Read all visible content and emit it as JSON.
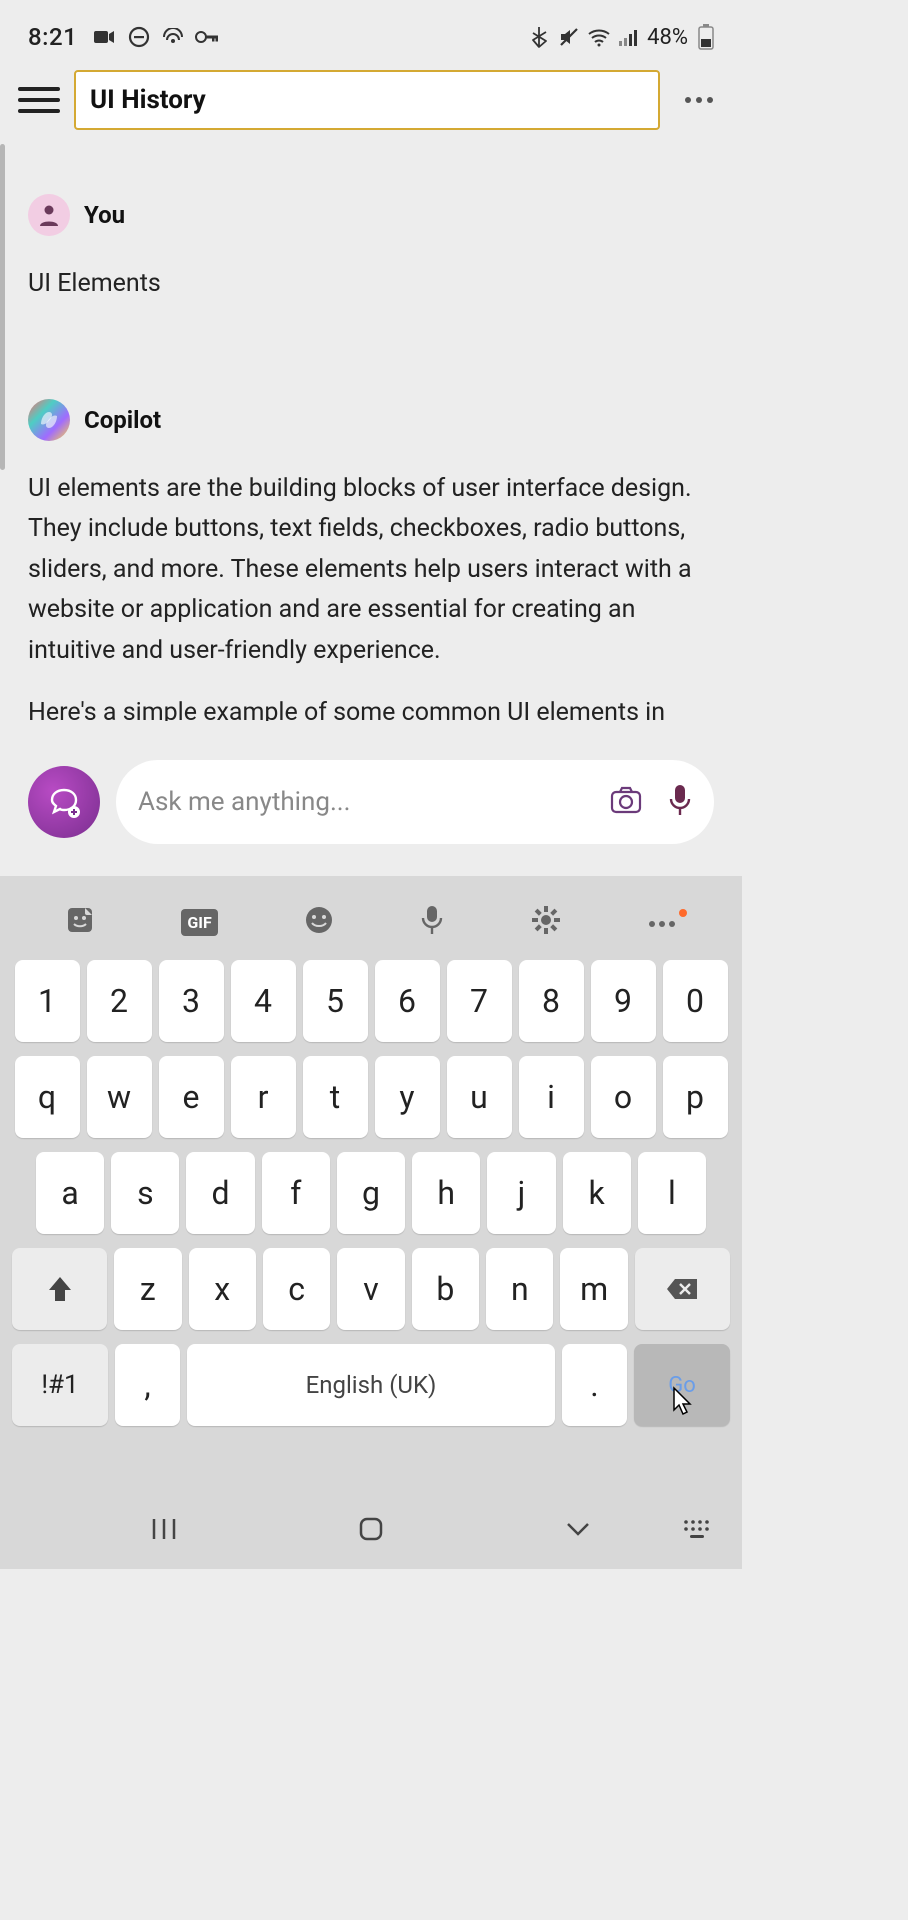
{
  "status": {
    "time": "8:21",
    "battery_pct": "48%"
  },
  "header": {
    "title_value": "UI History"
  },
  "chat": {
    "user_name": "You",
    "user_message": "UI Elements",
    "assistant_name": "Copilot",
    "assistant_p1": "UI elements are the building blocks of user interface design. They include buttons, text fields, checkboxes, radio buttons, sliders, and more. These elements help users interact with a website or application and are essential for creating an intuitive and user-friendly experience.",
    "assistant_p2": "Here's a simple example of some common UI elements in HTML:"
  },
  "composer": {
    "placeholder": "Ask me anything..."
  },
  "keyboard": {
    "toolbar": {
      "gif": "GIF"
    },
    "row_num": [
      "1",
      "2",
      "3",
      "4",
      "5",
      "6",
      "7",
      "8",
      "9",
      "0"
    ],
    "row1": [
      "q",
      "w",
      "e",
      "r",
      "t",
      "y",
      "u",
      "i",
      "o",
      "p"
    ],
    "row2": [
      "a",
      "s",
      "d",
      "f",
      "g",
      "h",
      "j",
      "k",
      "l"
    ],
    "row3": [
      "z",
      "x",
      "c",
      "v",
      "b",
      "n",
      "m"
    ],
    "symbols": "!#1",
    "comma": ",",
    "spacebar": "English (UK)",
    "period": ".",
    "go": "Go"
  }
}
